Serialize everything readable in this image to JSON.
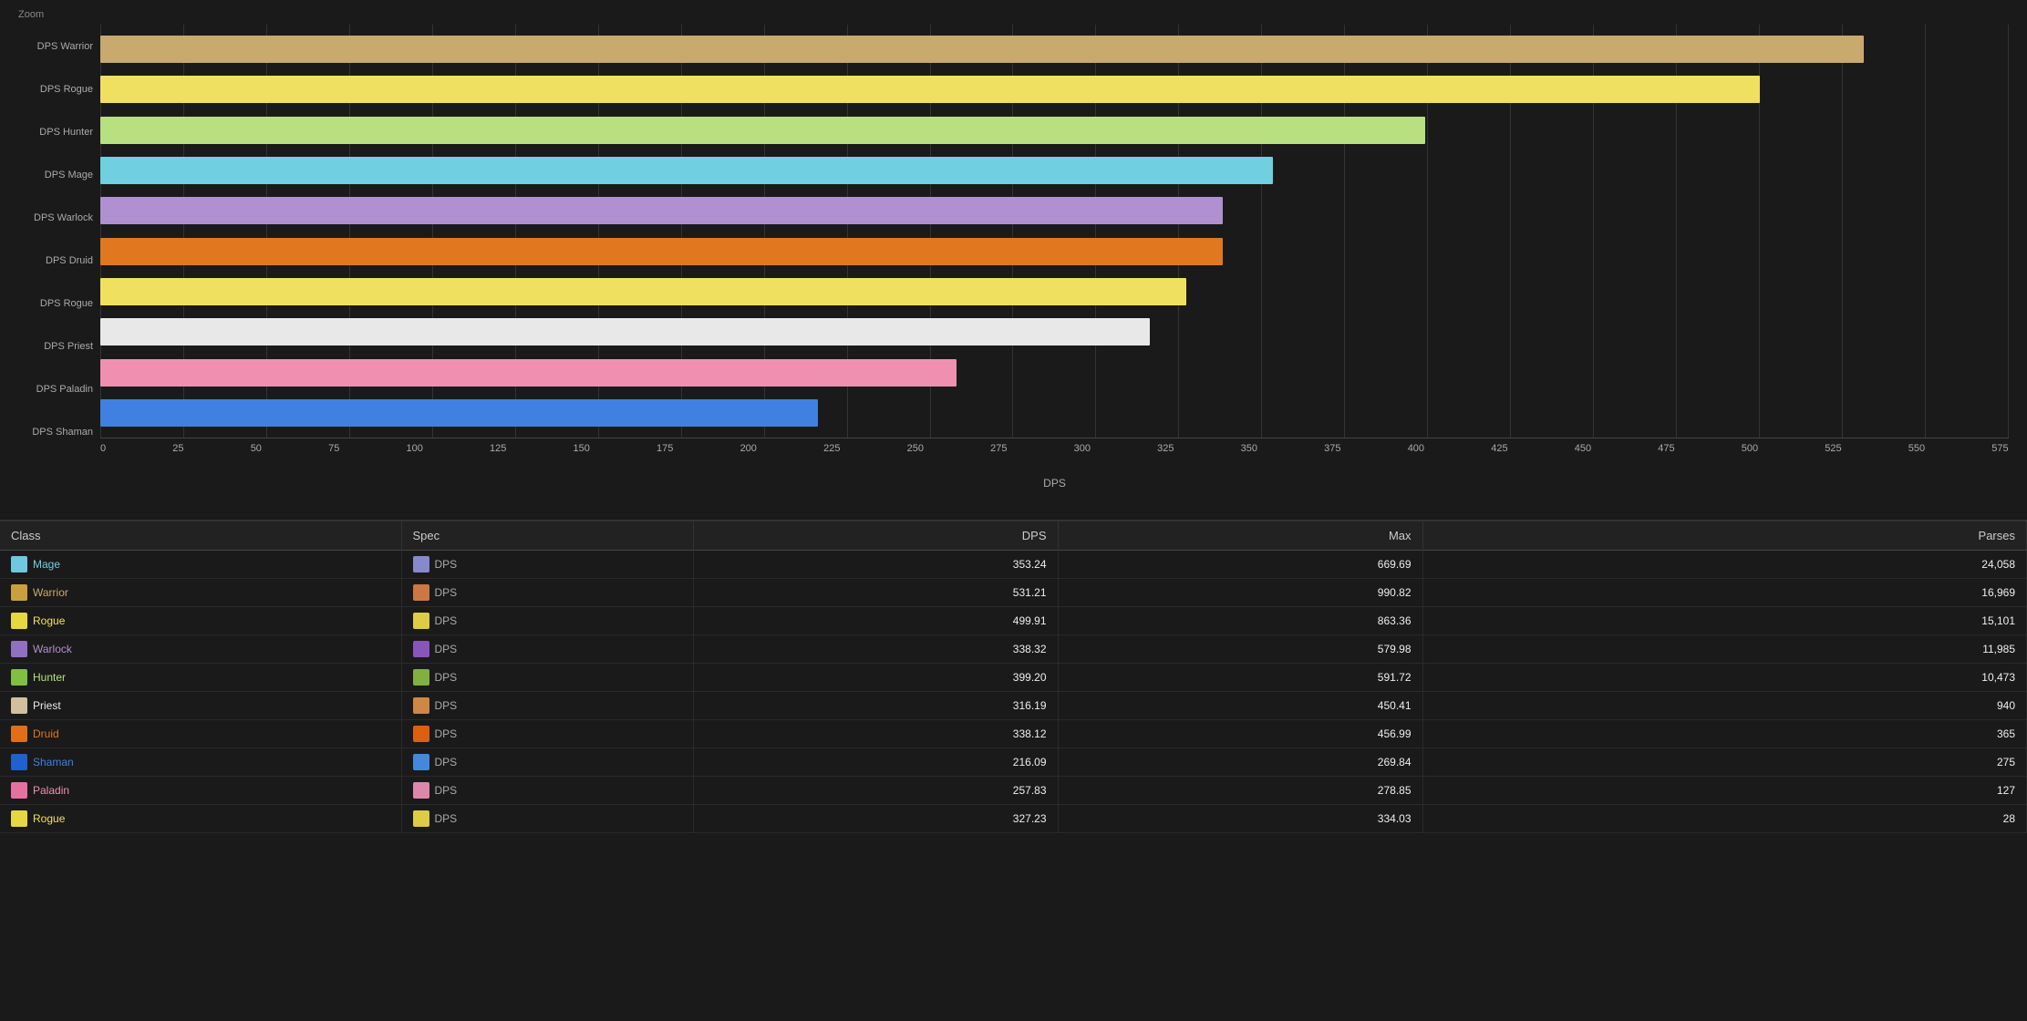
{
  "chart": {
    "zoom_label": "Zoom",
    "x_axis_label": "DPS",
    "x_ticks": [
      "0",
      "25",
      "50",
      "75",
      "100",
      "125",
      "150",
      "175",
      "200",
      "225",
      "250",
      "275",
      "300",
      "325",
      "350",
      "375",
      "400",
      "425",
      "450",
      "475",
      "500",
      "525",
      "550",
      "575"
    ],
    "max_value": 575,
    "bars": [
      {
        "label": "DPS Warrior",
        "value": 531.21,
        "color": "#c8a96e"
      },
      {
        "label": "DPS Rogue",
        "value": 499.91,
        "color": "#f0e060"
      },
      {
        "label": "DPS Hunter",
        "value": 399.2,
        "color": "#b8e080"
      },
      {
        "label": "DPS Mage",
        "value": 353.24,
        "color": "#70d0e0"
      },
      {
        "label": "DPS Warlock",
        "value": 338.32,
        "color": "#b090d0"
      },
      {
        "label": "DPS Druid",
        "value": 338.12,
        "color": "#e07820"
      },
      {
        "label": "DPS Rogue",
        "value": 327.23,
        "color": "#f0e060"
      },
      {
        "label": "DPS Priest",
        "value": 316.19,
        "color": "#e8e8e8"
      },
      {
        "label": "DPS Paladin",
        "value": 257.83,
        "color": "#f090b0"
      },
      {
        "label": "DPS Shaman",
        "value": 216.09,
        "color": "#4080e0"
      }
    ]
  },
  "table": {
    "headers": [
      "Class",
      "Spec",
      "DPS",
      "Max",
      "Parses"
    ],
    "rows": [
      {
        "class_name": "Mage",
        "class_color": "#70d0e0",
        "class_icon_color": "#70c8e0",
        "spec": "DPS",
        "spec_icon_color": "#8888cc",
        "dps": "353.24",
        "max": "669.69",
        "parses": "24,058"
      },
      {
        "class_name": "Warrior",
        "class_color": "#c8a96e",
        "class_icon_color": "#c8a040",
        "spec": "DPS",
        "spec_icon_color": "#cc7744",
        "dps": "531.21",
        "max": "990.82",
        "parses": "16,969"
      },
      {
        "class_name": "Rogue",
        "class_color": "#f0e060",
        "class_icon_color": "#e8d840",
        "spec": "DPS",
        "spec_icon_color": "#ddcc44",
        "dps": "499.91",
        "max": "863.36",
        "parses": "15,101"
      },
      {
        "class_name": "Warlock",
        "class_color": "#b090d0",
        "class_icon_color": "#9070c0",
        "spec": "DPS",
        "spec_icon_color": "#8855bb",
        "dps": "338.32",
        "max": "579.98",
        "parses": "11,985"
      },
      {
        "class_name": "Hunter",
        "class_color": "#b8e080",
        "class_icon_color": "#80c040",
        "spec": "DPS",
        "spec_icon_color": "#80b040",
        "dps": "399.20",
        "max": "591.72",
        "parses": "10,473"
      },
      {
        "class_name": "Priest",
        "class_color": "#e8e8e8",
        "class_icon_color": "#d0c0a0",
        "spec": "DPS",
        "spec_icon_color": "#cc8844",
        "dps": "316.19",
        "max": "450.41",
        "parses": "940"
      },
      {
        "class_name": "Druid",
        "class_color": "#e07820",
        "class_icon_color": "#e07018",
        "spec": "DPS",
        "spec_icon_color": "#dd6010",
        "dps": "338.12",
        "max": "456.99",
        "parses": "365"
      },
      {
        "class_name": "Shaman",
        "class_color": "#4080e0",
        "class_icon_color": "#2060d0",
        "spec": "DPS",
        "spec_icon_color": "#4488dd",
        "dps": "216.09",
        "max": "269.84",
        "parses": "275"
      },
      {
        "class_name": "Paladin",
        "class_color": "#f090b0",
        "class_icon_color": "#e870a0",
        "spec": "DPS",
        "spec_icon_color": "#dd88aa",
        "dps": "257.83",
        "max": "278.85",
        "parses": "127"
      },
      {
        "class_name": "Rogue",
        "class_color": "#f0e060",
        "class_icon_color": "#e8d840",
        "spec": "DPS",
        "spec_icon_color": "#ddcc44",
        "dps": "327.23",
        "max": "334.03",
        "parses": "28"
      }
    ]
  }
}
